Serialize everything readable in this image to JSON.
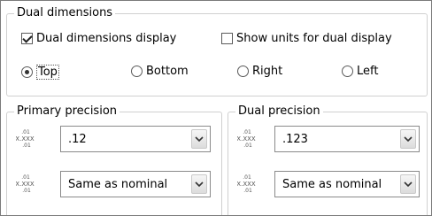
{
  "dual_dimensions": {
    "legend": "Dual dimensions",
    "display_label": "Dual dimensions display",
    "display_checked": true,
    "show_units_label": "Show units for dual display",
    "show_units_checked": false,
    "positions": [
      {
        "label": "Top",
        "selected": true
      },
      {
        "label": "Bottom",
        "selected": false
      },
      {
        "label": "Right",
        "selected": false
      },
      {
        "label": "Left",
        "selected": false
      }
    ]
  },
  "primary_precision": {
    "legend": "Primary precision",
    "value_select": ".12",
    "tolerance_select": "Same as nominal"
  },
  "dual_precision": {
    "legend": "Dual precision",
    "value_select": ".123",
    "tolerance_select": "Same as nominal"
  },
  "colors": {
    "border": "#7a7a7a",
    "group_border": "#d0d0d0",
    "dropdown_arrow": "#333333"
  }
}
